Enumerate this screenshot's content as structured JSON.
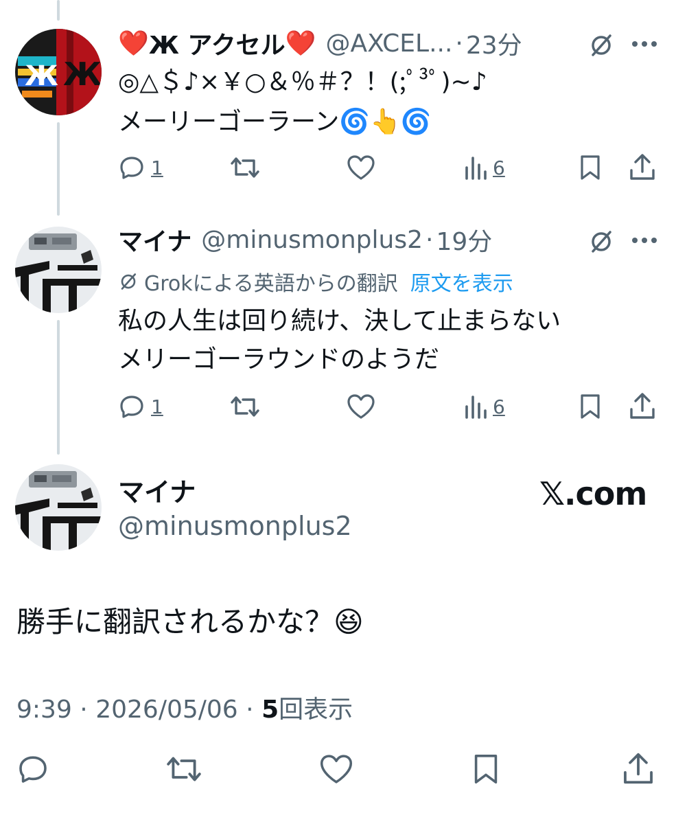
{
  "tweets": [
    {
      "name": "Ж アクセル",
      "heart_left": "❤️",
      "heart_right": "❤️",
      "handle": "@AXCEL...",
      "time": "23分",
      "lines": [
        "◎△＄♪×￥○＆％＃？！(;ﾟ³ﾟ)~♪",
        "メーリーゴーラーン🌀👆🌀"
      ],
      "reply_count": "1",
      "view_count": "6"
    },
    {
      "name": "マイナ",
      "handle": "@minusmonplus2",
      "time": "19分",
      "translate_note": "Grokによる英語からの翻訳",
      "translate_link": "原文を表示",
      "lines": [
        "私の人生は回り続け、決して止まらない",
        "メリーゴーラウンドのようだ"
      ],
      "reply_count": "1",
      "view_count": "6"
    }
  ],
  "main": {
    "name": "マイナ",
    "handle": "@minusmonplus2",
    "brand": "𝕏.com",
    "text": "勝手に翻訳されるかな？😆",
    "time": "9:39",
    "date": "2026/05/06",
    "view_count": "5",
    "view_label": "回表示"
  },
  "separator": "·",
  "colors": {
    "text": "#0f1419",
    "secondary": "#536471",
    "link": "#1d9bf0",
    "thread_line": "#cfd9de"
  },
  "icons": [
    "grok-icon",
    "more-icon",
    "reply-icon",
    "repost-icon",
    "like-icon",
    "views-icon",
    "bookmark-icon",
    "share-icon"
  ]
}
